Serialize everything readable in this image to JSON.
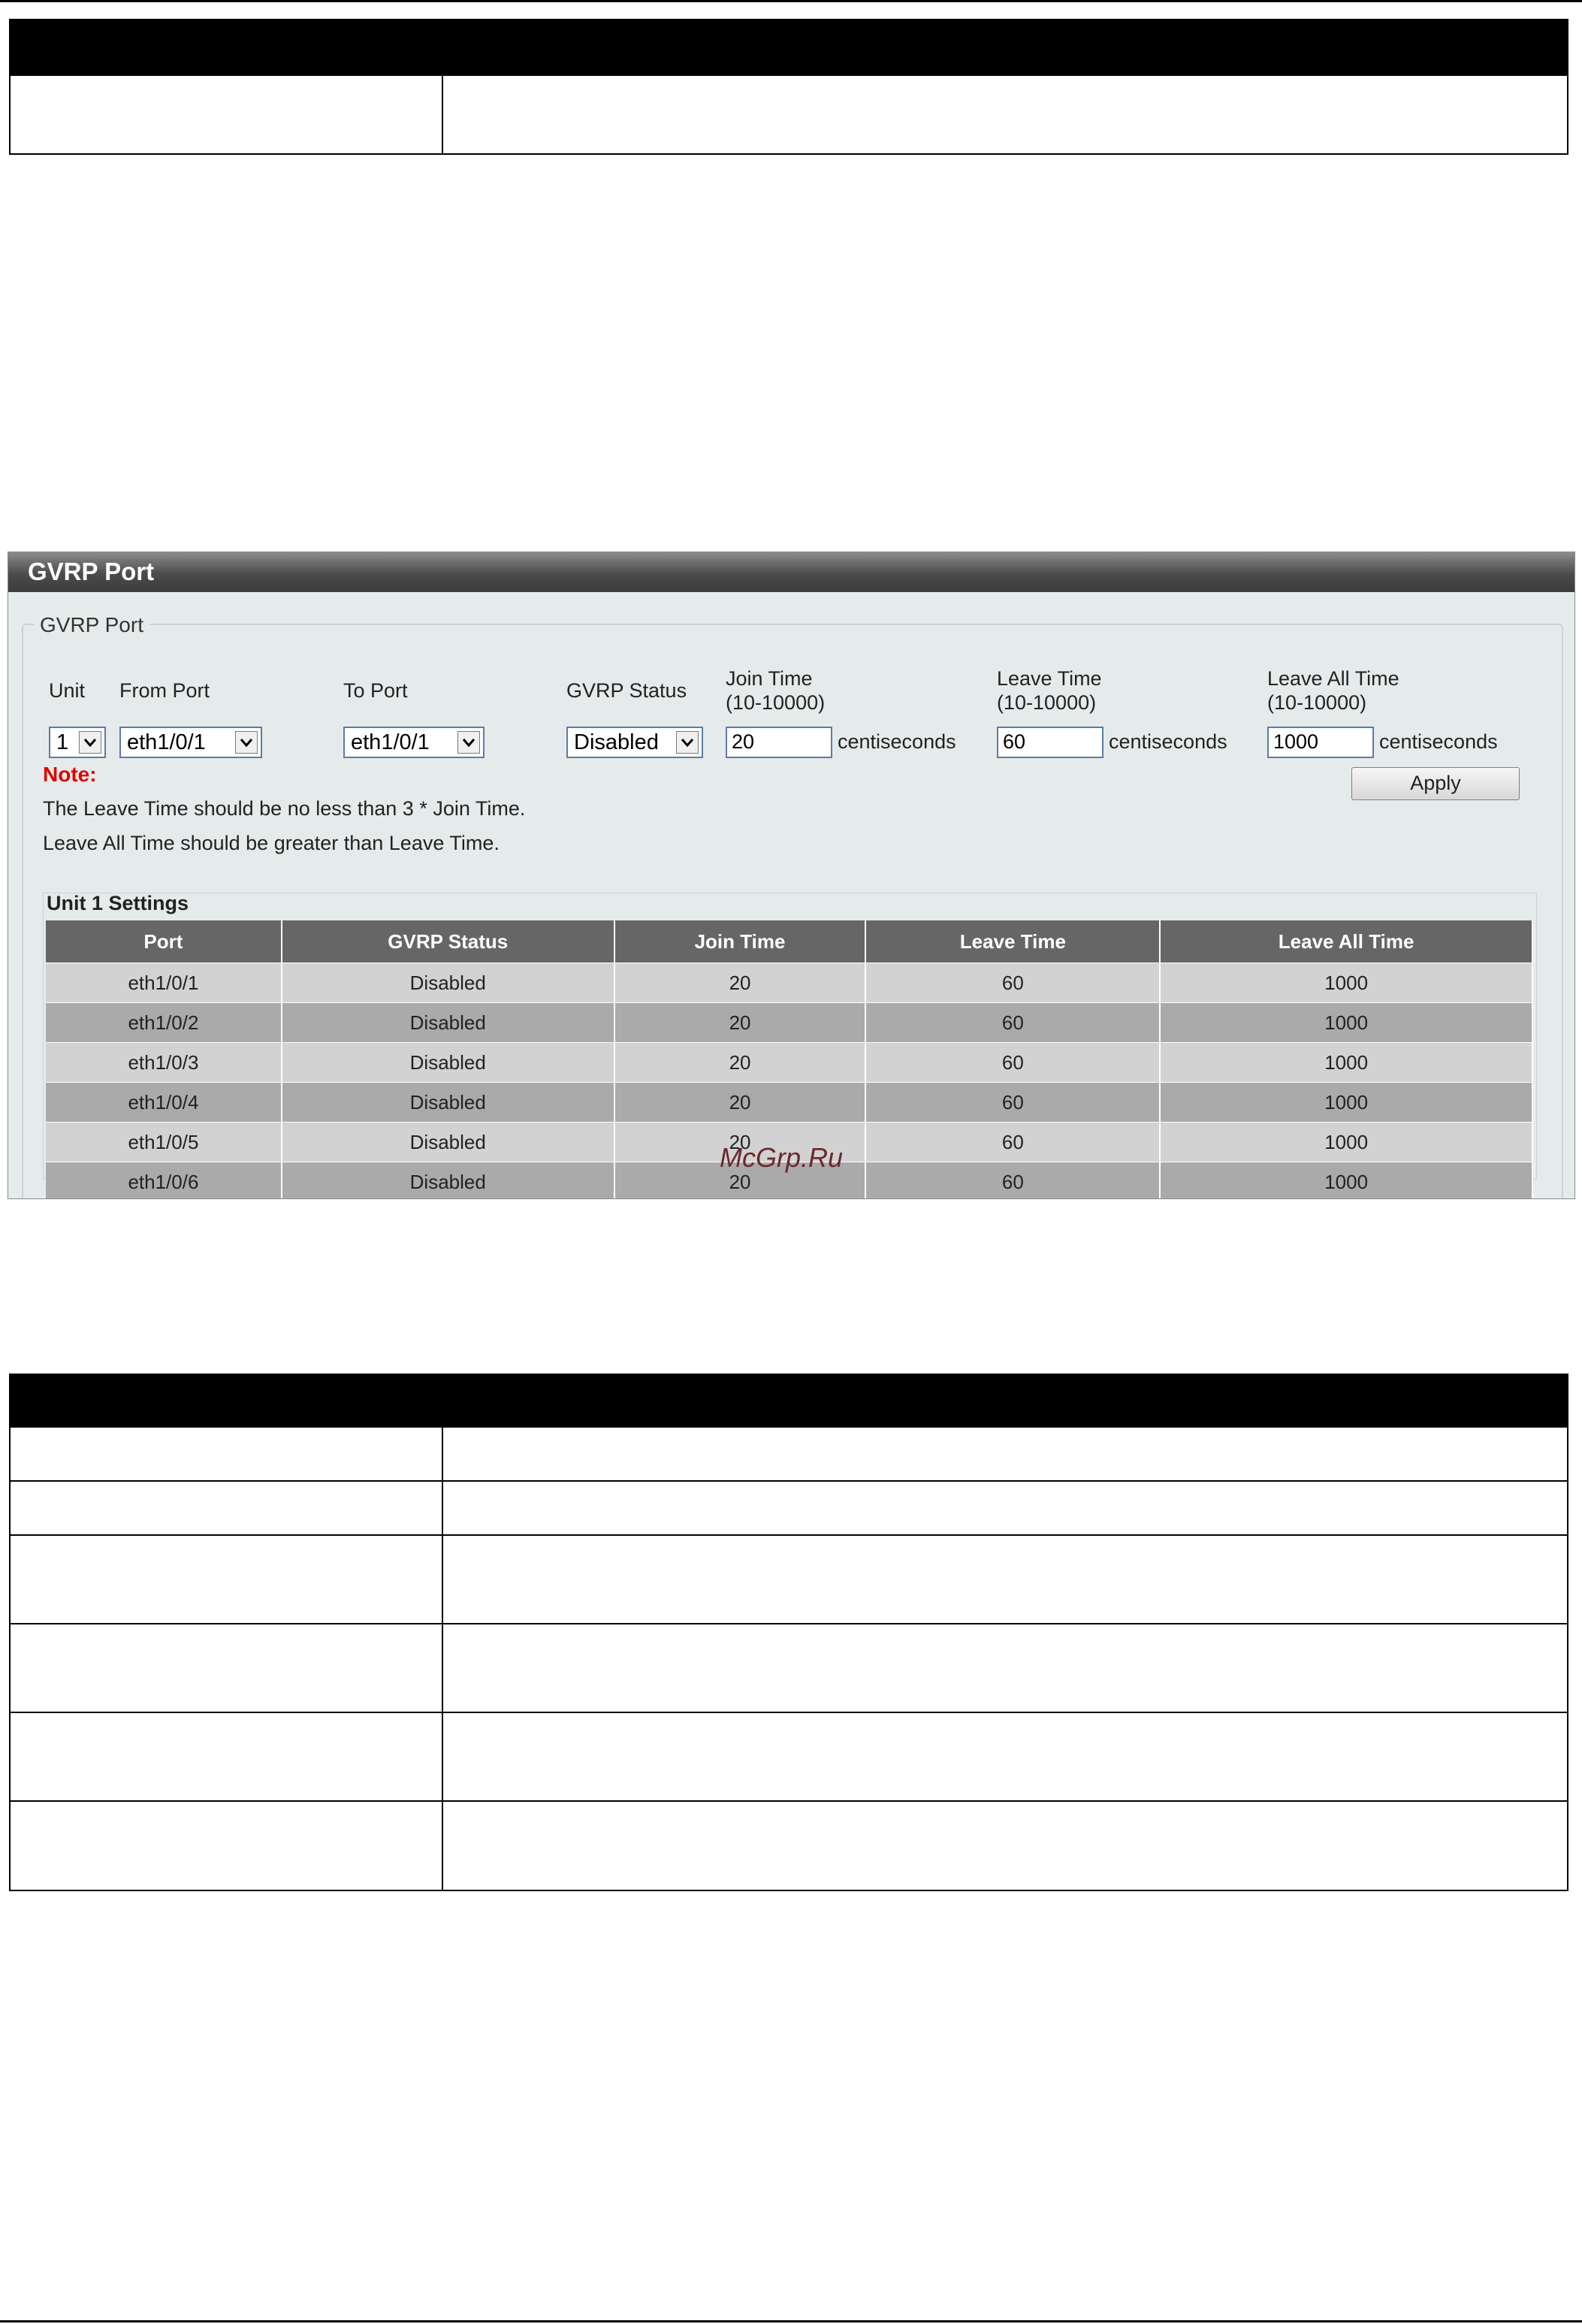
{
  "panel": {
    "title": "GVRP Port",
    "fieldset_legend": "GVRP Port",
    "labels": {
      "unit": "Unit",
      "from_port": "From Port",
      "to_port": "To Port",
      "gvrp_status": "GVRP Status",
      "join_time": "Join Time",
      "join_range": "(10-10000)",
      "leave_time": "Leave Time",
      "leave_range": "(10-10000)",
      "leave_all_time": "Leave All Time",
      "leave_all_range": "(10-10000)",
      "centiseconds": "centiseconds"
    },
    "form": {
      "unit": "1",
      "from_port": "eth1/0/1",
      "to_port": "eth1/0/1",
      "gvrp_status": "Disabled",
      "join_time": "20",
      "leave_time": "60",
      "leave_all_time": "1000"
    },
    "apply_label": "Apply",
    "note_title": "Note:",
    "note_lines": [
      "The Leave Time should be no less than 3 * Join Time.",
      "Leave All Time should be greater than Leave Time."
    ],
    "unit_settings_title": "Unit 1 Settings",
    "table": {
      "columns": [
        "Port",
        "GVRP Status",
        "Join Time",
        "Leave Time",
        "Leave All Time"
      ],
      "rows": [
        [
          "eth1/0/1",
          "Disabled",
          "20",
          "60",
          "1000"
        ],
        [
          "eth1/0/2",
          "Disabled",
          "20",
          "60",
          "1000"
        ],
        [
          "eth1/0/3",
          "Disabled",
          "20",
          "60",
          "1000"
        ],
        [
          "eth1/0/4",
          "Disabled",
          "20",
          "60",
          "1000"
        ],
        [
          "eth1/0/5",
          "Disabled",
          "20",
          "60",
          "1000"
        ],
        [
          "eth1/0/6",
          "Disabled",
          "20",
          "60",
          "1000"
        ]
      ]
    }
  },
  "watermark": "McGrp.Ru"
}
